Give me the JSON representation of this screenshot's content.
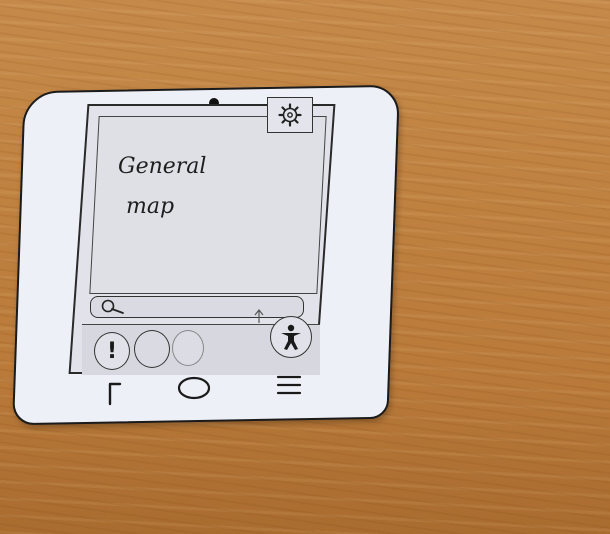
{
  "map": {
    "title_line1": "General",
    "title_line2": "map"
  },
  "icons": {
    "settings": "gear-icon",
    "search": "search-icon",
    "alert": "alert-icon",
    "accessibility": "accessibility-icon",
    "back": "back-icon",
    "home": "home-icon",
    "menu": "menu-icon",
    "up_arrow": "arrow-up-icon"
  },
  "colors": {
    "paper": "#eef0f7",
    "table": "#bf8140",
    "ink": "#1b1b1b"
  }
}
